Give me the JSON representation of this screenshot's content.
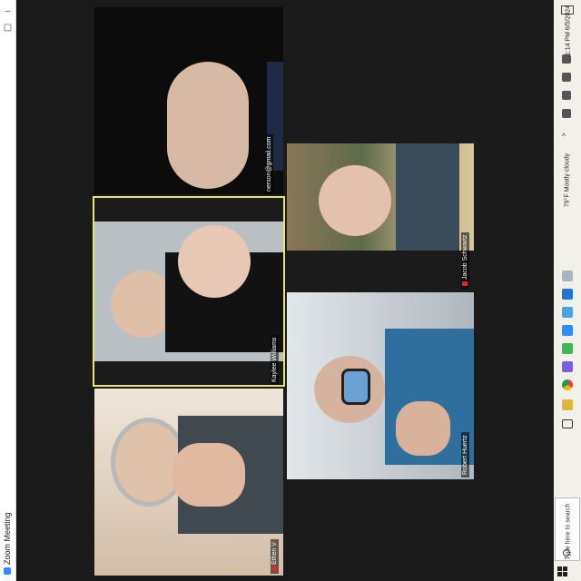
{
  "window": {
    "title": "Zoom Meeting",
    "min_glyph": "–",
    "max_glyph": "▢"
  },
  "participants": [
    {
      "name": "nerson@gmail.com",
      "muted": false,
      "active": false
    },
    {
      "name": "Kaylee Williams",
      "muted": false,
      "active": true
    },
    {
      "name": "Ethen V",
      "muted": true,
      "active": false
    },
    {
      "name": "Jacob Schwartz",
      "muted": true,
      "active": false
    },
    {
      "name": "Robert Huertz",
      "muted": false,
      "active": false
    }
  ],
  "taskbar": {
    "time": "1:14 PM",
    "date": "6/5/2024",
    "weather": "79°F  Mostly cloudy",
    "search_placeholder": "Type here to search",
    "icons": [
      "edge-icon",
      "zoom-icon",
      "teams-icon",
      "folder-icon",
      "chrome-icon",
      "store-icon",
      "app-icon",
      "explorer-icon",
      "task-view-icon"
    ]
  },
  "colors": {
    "active_border": "#e6e37a",
    "muted_red": "#e23344",
    "taskbar_bg": "#f1f1e9"
  }
}
